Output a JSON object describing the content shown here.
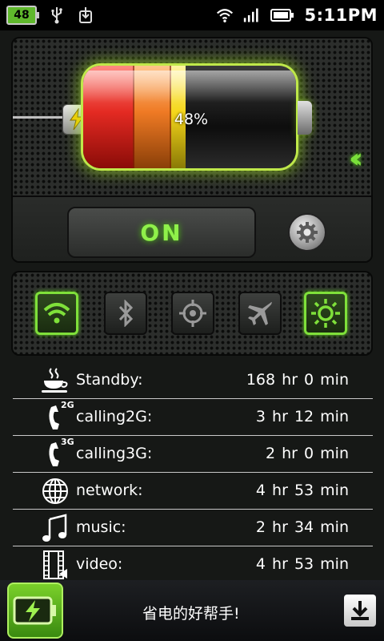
{
  "status_bar": {
    "battery_level": "48",
    "icons": [
      "usb-icon",
      "download-icon",
      "wifi-icon",
      "signal-icon",
      "battery-icon"
    ],
    "time": "5:11PM"
  },
  "battery": {
    "percent_text": "48%",
    "level": 0.48,
    "charging": true,
    "colors": {
      "red": "#e42a22",
      "orange": "#ef7a24",
      "yellow": "#f5d61a",
      "glow": "#bfe84a"
    }
  },
  "power": {
    "on_label": "ON",
    "accent": "#8ff04a"
  },
  "toggles": [
    {
      "name": "wifi",
      "icon": "wifi-icon",
      "active": true
    },
    {
      "name": "bluetooth",
      "icon": "bluetooth-icon",
      "active": false
    },
    {
      "name": "gps",
      "icon": "crosshair-icon",
      "active": false
    },
    {
      "name": "airplane",
      "icon": "airplane-icon",
      "active": false
    },
    {
      "name": "brightness",
      "icon": "sun-icon",
      "active": true
    }
  ],
  "usage": [
    {
      "label": "Standby:",
      "value": "168 hr  0 min",
      "icon": "coffee-cup-icon",
      "badge": ""
    },
    {
      "label": "calling2G:",
      "value": "3 hr  12 min",
      "icon": "phone-icon",
      "badge": "2G"
    },
    {
      "label": "calling3G:",
      "value": "2 hr  0 min",
      "icon": "phone-icon",
      "badge": "3G"
    },
    {
      "label": "network:",
      "value": "4 hr  53 min",
      "icon": "globe-icon",
      "badge": ""
    },
    {
      "label": "music:",
      "value": "2 hr  34 min",
      "icon": "music-note-icon",
      "badge": ""
    },
    {
      "label": "video:",
      "value": "4 hr  53 min",
      "icon": "film-icon",
      "badge": ""
    }
  ],
  "ad": {
    "text": "省电的好帮手!",
    "icon": "battery-bolt-icon"
  }
}
